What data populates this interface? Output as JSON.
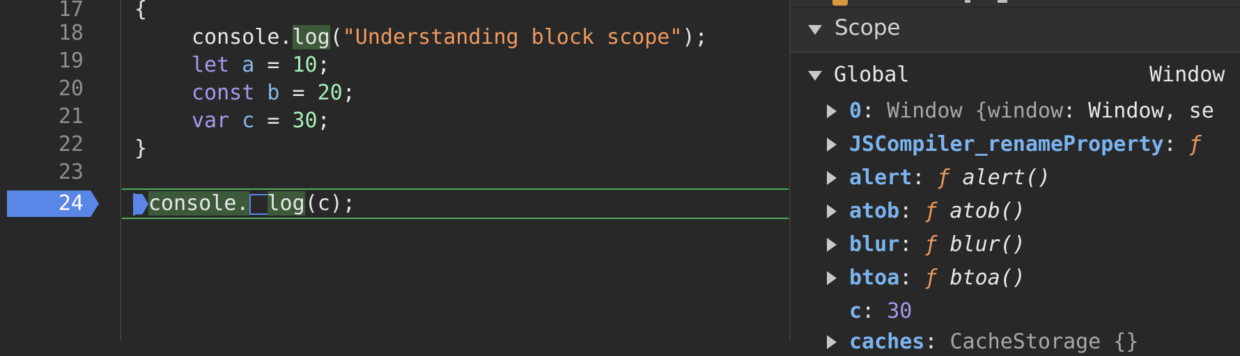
{
  "editor": {
    "line_numbers": [
      "17",
      "18",
      "19",
      "20",
      "21",
      "22",
      "23",
      "24"
    ],
    "active_line": "24",
    "lines": {
      "l17": "{",
      "l18_obj": "console.",
      "l18_fn": "log",
      "l18_open": "(",
      "l18_str": "\"Understanding block scope\"",
      "l18_close": ");",
      "l19_kw": "let",
      "l19_var": "a",
      "l19_eq": " = ",
      "l19_num": "10",
      "l19_end": ";",
      "l20_kw": "const",
      "l20_var": "b",
      "l20_eq": " = ",
      "l20_num": "20",
      "l20_end": ";",
      "l21_kw": "var",
      "l21_var": "c",
      "l21_eq": " = ",
      "l21_num": "30",
      "l21_end": ";",
      "l22": "}",
      "l24_obj": "console.",
      "l24_fn": "log",
      "l24_args": "(c);"
    }
  },
  "scope": {
    "title": "Scope",
    "global_label": "Global",
    "global_type": "Window",
    "properties": [
      {
        "name": "0",
        "colon": ":",
        "value_a": " Window {",
        "value_b": "window",
        "value_c": ": Window, se"
      },
      {
        "name": "JSCompiler_renameProperty",
        "colon": ":",
        "fsym": " ƒ"
      },
      {
        "name": "alert",
        "colon": ":",
        "fsym": " ƒ",
        "sig": " alert()"
      },
      {
        "name": "atob",
        "colon": ":",
        "fsym": " ƒ",
        "sig": " atob()"
      },
      {
        "name": "blur",
        "colon": ":",
        "fsym": " ƒ",
        "sig": " blur()"
      },
      {
        "name": "btoa",
        "colon": ":",
        "fsym": " ƒ",
        "sig": " btoa()"
      },
      {
        "name": "c",
        "colon": ":",
        "value": " 30"
      },
      {
        "name": "caches",
        "colon": ":",
        "value": " CacheStorage {}"
      }
    ]
  },
  "colors": {
    "accent_blue": "#5a86e8",
    "exec_line_green": "#4caf5f",
    "keyword": "#a799f0",
    "string": "#f09a5e",
    "number": "#a8f0b8"
  },
  "icons": [
    "collapse-triangle-icon",
    "expand-triangle-icon",
    "breakpoint-marker-icon",
    "continue-marker-icon",
    "caret-icon"
  ]
}
